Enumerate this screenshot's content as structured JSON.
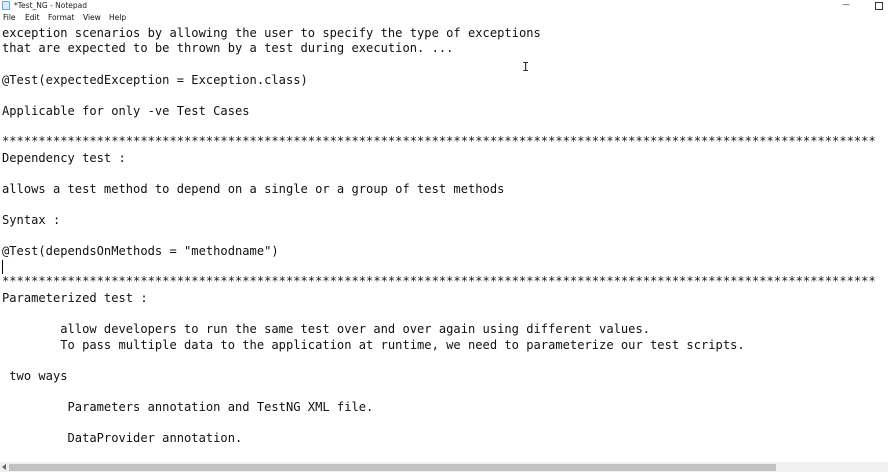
{
  "window": {
    "title": "*Test_NG - Notepad",
    "minimize_glyph": "—"
  },
  "menu": {
    "file": "File",
    "edit": "Edit",
    "format": "Format",
    "view": "View",
    "help": "Help"
  },
  "editor": {
    "lines": [
      "exception scenarios by allowing the user to specify the type of exceptions",
      "that are expected to be thrown by a test during execution. ...",
      "@Test(expectedException = Exception.class)",
      "Applicable for only -ve Test Cases",
      "************************************************************************************************************************",
      "Dependency test :",
      "allows a test method to depend on a single or a group of test methods",
      "Syntax :",
      "@Test(dependsOnMethods = \"methodname\")",
      "************************************************************************************************************************",
      "Parameterized test :",
      "        allow developers to run the same test over and over again using different values.",
      "        To pass multiple data to the application at runtime, we need to parameterize our test scripts.",
      " two ways",
      "         Parameters annotation and TestNG XML file.",
      "         DataProvider annotation."
    ],
    "cursor_glyph": "I"
  }
}
